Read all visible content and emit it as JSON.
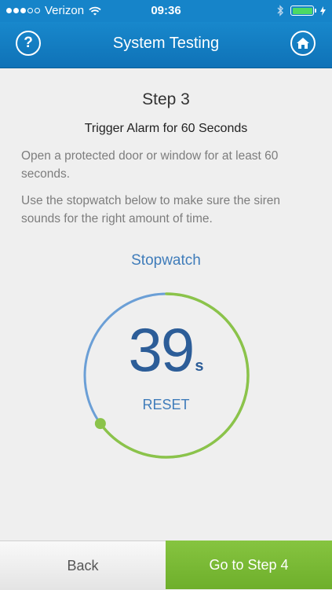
{
  "status_bar": {
    "carrier": "Verizon",
    "time": "09:36",
    "signal_bars_filled": 3,
    "signal_bars_total": 5,
    "battery_color": "#4cd964"
  },
  "nav": {
    "title": "System Testing",
    "help_icon": "question-mark",
    "home_icon": "house",
    "background": "#1684c9"
  },
  "step": {
    "title": "Step 3",
    "subtitle": "Trigger Alarm for 60 Seconds",
    "paragraphs": [
      "Open a protected door or window for at least 60 seconds.",
      "Use the stopwatch below to make sure the siren sounds for the right amount of time."
    ]
  },
  "stopwatch": {
    "label": "Stopwatch",
    "value": "39",
    "unit": "s",
    "reset_label": "RESET",
    "progress_fraction": 0.65,
    "colors": {
      "track": "#6b9fd6",
      "progress": "#8bc34a",
      "text": "#2c5d98"
    }
  },
  "footer": {
    "back_label": "Back",
    "next_label": "Go to Step 4"
  }
}
